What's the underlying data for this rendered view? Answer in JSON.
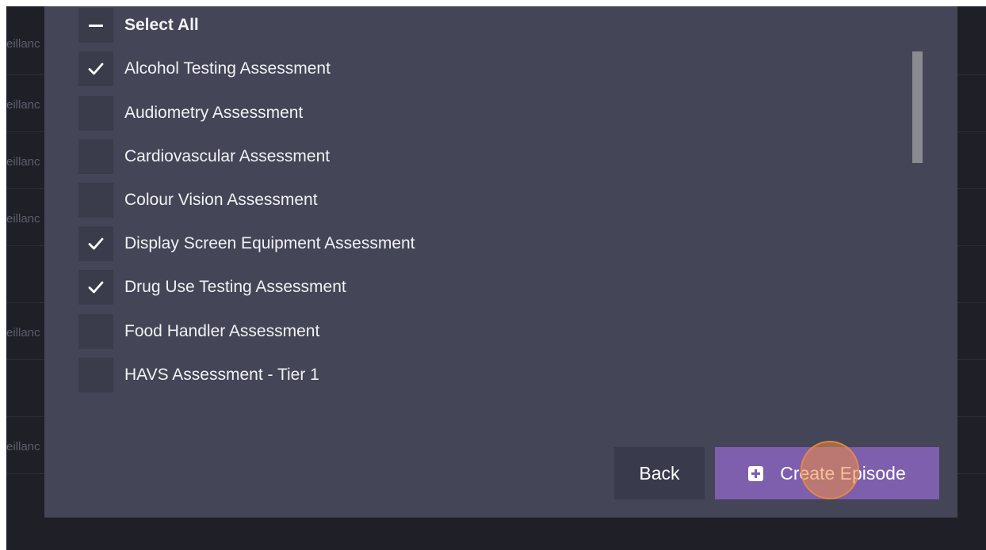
{
  "background": {
    "row_fragments": [
      "eillanc",
      "eillanc",
      "eillanc",
      "eillanc",
      "eillanc",
      "eillanc"
    ]
  },
  "checklist": {
    "select_all": {
      "label": "Select All",
      "state": "indeterminate"
    },
    "items": [
      {
        "label": "Alcohol Testing Assessment",
        "checked": true
      },
      {
        "label": "Audiometry Assessment",
        "checked": false
      },
      {
        "label": "Cardiovascular Assessment",
        "checked": false
      },
      {
        "label": "Colour Vision Assessment",
        "checked": false
      },
      {
        "label": "Display Screen Equipment Assessment",
        "checked": true
      },
      {
        "label": "Drug Use Testing Assessment",
        "checked": true
      },
      {
        "label": "Food Handler Assessment",
        "checked": false
      },
      {
        "label": "HAVS Assessment - Tier 1",
        "checked": false
      }
    ]
  },
  "footer": {
    "back_label": "Back",
    "create_label": "Create Episode",
    "create_icon": "plus-square-icon"
  },
  "colors": {
    "modal_bg": "#444556",
    "checkbox_bg": "#3a3b4b",
    "primary": "#7e5fae",
    "click_marker": "#ec8b42"
  }
}
